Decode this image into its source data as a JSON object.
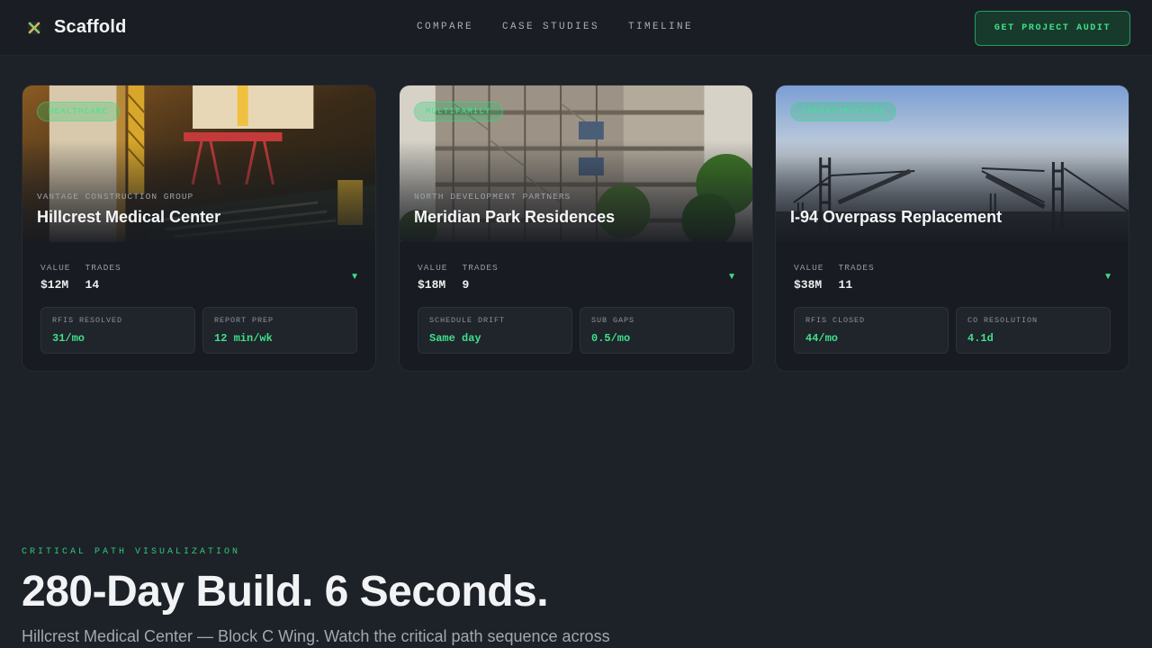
{
  "brand": {
    "name": "Scaffold",
    "icon": "x-cross-icon"
  },
  "nav": {
    "items": [
      "COMPARE",
      "CASE STUDIES",
      "TIMELINE"
    ]
  },
  "cta": {
    "label": "GET PROJECT AUDIT"
  },
  "colors": {
    "accent": "#3ee08a",
    "background": "#1d2128",
    "card": "#181b21"
  },
  "cards": [
    {
      "tag": "HEALTHCARE",
      "client": "VANTAGE CONSTRUCTION GROUP",
      "title": "Hillcrest Medical Center",
      "value_label": "VALUE",
      "value": "$12M",
      "trades_label": "TRADES",
      "trades": "14",
      "metrics": [
        {
          "label": "RFIS RESOLVED",
          "value": "31/mo"
        },
        {
          "label": "REPORT PREP",
          "value": "12 min/wk"
        }
      ]
    },
    {
      "tag": "MULTIFAMILY",
      "client": "NORTH DEVELOPMENT PARTNERS",
      "title": "Meridian Park Residences",
      "value_label": "VALUE",
      "value": "$18M",
      "trades_label": "TRADES",
      "trades": "9",
      "metrics": [
        {
          "label": "SCHEDULE DRIFT",
          "value": "Same day"
        },
        {
          "label": "SUB GAPS",
          "value": "0.5/mo"
        }
      ]
    },
    {
      "tag": "INFRASTRUCTURE",
      "client": "",
      "title": "I-94 Overpass Replacement",
      "value_label": "VALUE",
      "value": "$38M",
      "trades_label": "TRADES",
      "trades": "11",
      "metrics": [
        {
          "label": "RFIS CLOSED",
          "value": "44/mo"
        },
        {
          "label": "CO RESOLUTION",
          "value": "4.1d"
        }
      ]
    }
  ],
  "section": {
    "eyebrow": "CRITICAL PATH VISUALIZATION",
    "headline": "280-Day Build. 6 Seconds.",
    "subline": "Hillcrest Medical Center — Block C Wing. Watch the critical path sequence across"
  }
}
